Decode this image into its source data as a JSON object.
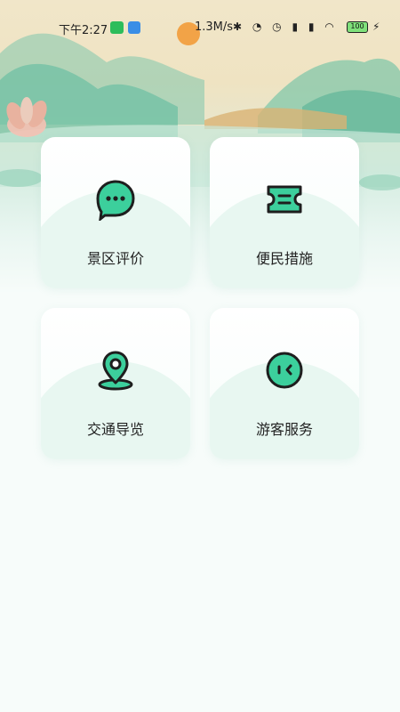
{
  "status_bar": {
    "time": "下午2:27",
    "speed": "1.3M/s",
    "battery": "100"
  },
  "menu": {
    "items": [
      {
        "label": "景区评价",
        "icon": "chat-bubble-icon"
      },
      {
        "label": "便民措施",
        "icon": "ticket-icon"
      },
      {
        "label": "交通导览",
        "icon": "location-pin-icon"
      },
      {
        "label": "游客服务",
        "icon": "service-face-icon"
      }
    ]
  },
  "colors": {
    "accent": "#3ccf9c",
    "icon_stroke": "#1e1e1e"
  }
}
